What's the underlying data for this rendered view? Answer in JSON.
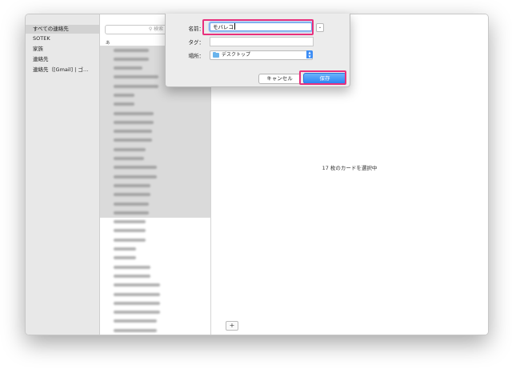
{
  "sidebar": {
    "items": [
      {
        "label": "すべての連絡先",
        "selected": true
      },
      {
        "label": "SOTEK",
        "selected": false
      },
      {
        "label": "家族",
        "selected": false
      },
      {
        "label": "連絡先",
        "selected": false
      },
      {
        "label": "連絡先（[Gmail] | ゴ…",
        "selected": false
      }
    ]
  },
  "list": {
    "search_placeholder": "検索",
    "section_letter": "あ",
    "rows": [
      {
        "selected": true
      },
      {
        "selected": true
      },
      {
        "selected": true
      },
      {
        "selected": true
      },
      {
        "selected": true
      },
      {
        "selected": true
      },
      {
        "selected": true
      },
      {
        "selected": true
      },
      {
        "selected": true
      },
      {
        "selected": true
      },
      {
        "selected": true
      },
      {
        "selected": true
      },
      {
        "selected": true
      },
      {
        "selected": true
      },
      {
        "selected": true
      },
      {
        "selected": true
      },
      {
        "selected": true
      },
      {
        "selected": true
      },
      {
        "selected": true
      },
      {
        "selected": false
      },
      {
        "selected": false
      },
      {
        "selected": false
      },
      {
        "selected": false
      },
      {
        "selected": false
      },
      {
        "selected": false
      },
      {
        "selected": false
      },
      {
        "selected": false
      },
      {
        "selected": false
      },
      {
        "selected": false
      },
      {
        "selected": false
      },
      {
        "selected": false
      },
      {
        "selected": false
      },
      {
        "selected": false
      }
    ]
  },
  "detail": {
    "status_text": "17 枚のカードを選択中",
    "add_label": "+"
  },
  "save_sheet": {
    "name_label": "名前：",
    "name_value": "モバレコ",
    "tag_label": "タグ：",
    "location_label": "場所：",
    "location_value": "デスクトップ",
    "cancel_label": "キャンセル",
    "save_label": "保存"
  },
  "colors": {
    "highlight": "#e8307c",
    "accent": "#2a84f3"
  }
}
